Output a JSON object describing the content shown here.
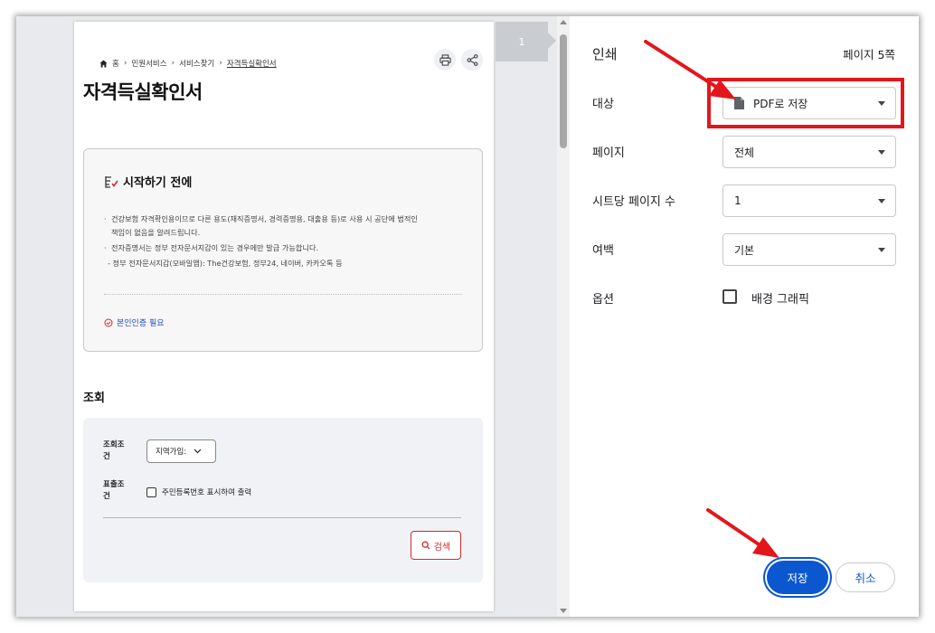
{
  "preview": {
    "page_number": "1",
    "breadcrumb": [
      "홈",
      "민원서비스",
      "서비스찾기",
      "자격득실확인서"
    ],
    "page_title": "자격득실확인서",
    "info": {
      "heading": "시작하기 전에",
      "bullet1": "건강보험 자격확인용이므로 다른 용도(재직증명서, 경력증명용, 대출용 등)로 사용 시 공단에 법적인",
      "bullet1b": "책임이 없음을 알려드립니다.",
      "bullet2": "전자증명서는 정부 전자문서지갑이 있는 경우에만 발급 가능합니다.",
      "bullet3": "- 정부 전자문서지갑(모바일앱): The건강보험, 정부24, 네이버, 카카오톡 등",
      "auth_link": "본인인증 필요"
    },
    "query": {
      "section_title": "조회",
      "cond_label": "조회조건",
      "cond_value": "지역가입:",
      "output_label": "표출조건",
      "output_option": "주민등록번호 표시하여 출력",
      "search_label": "검색"
    }
  },
  "panel": {
    "title": "인쇄",
    "sheets": "페이지 5쪽",
    "destination_label": "대상",
    "destination_value": "PDF로 저장",
    "pages_label": "페이지",
    "pages_value": "전체",
    "per_sheet_label": "시트당 페이지 수",
    "per_sheet_value": "1",
    "margins_label": "여백",
    "margins_value": "기본",
    "options_label": "옵션",
    "bg_graphics_label": "배경 그래픽",
    "bg_graphics_checked": false,
    "save_label": "저장",
    "cancel_label": "취소"
  },
  "colors": {
    "accent": "#0b57d0",
    "annotation": "#e3161b",
    "search_red": "#d22a2a"
  }
}
